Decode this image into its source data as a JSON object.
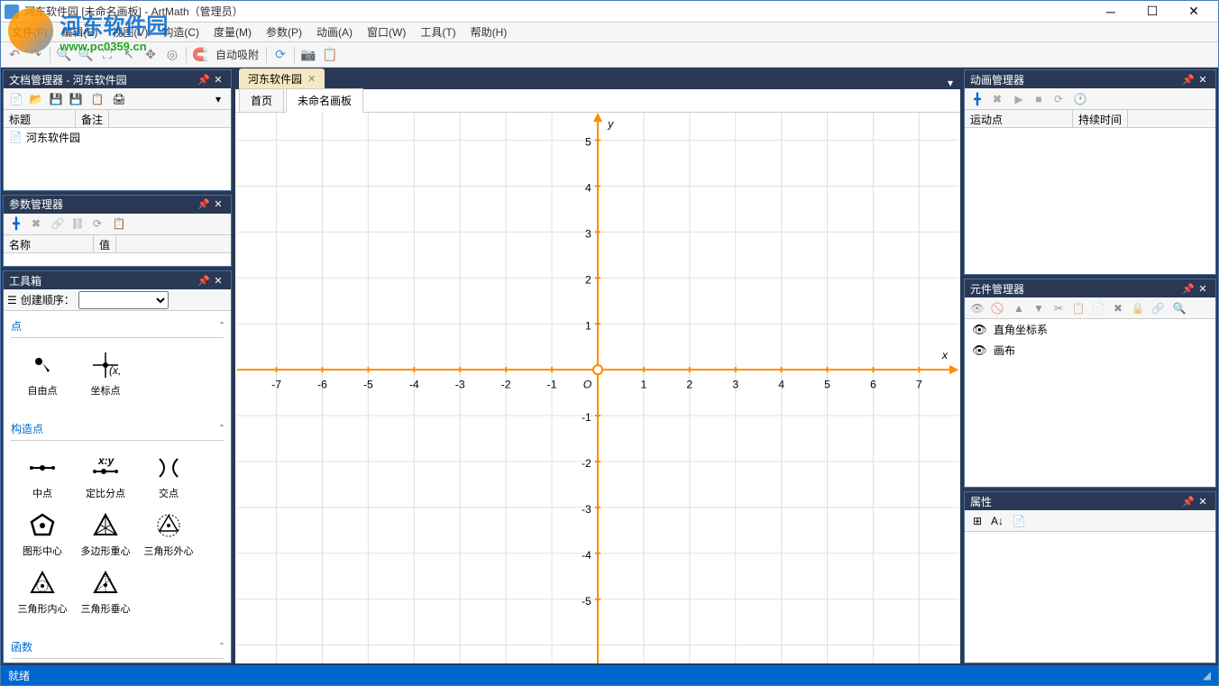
{
  "window": {
    "title": "河东软件园 [未命名画板] - ArtMath（管理员）"
  },
  "watermark": {
    "text": "河东软件园",
    "url": "www.pc0359.cn"
  },
  "menubar": [
    "文件(F)",
    "编辑(E)",
    "视图(V)",
    "构造(C)",
    "度量(M)",
    "参数(P)",
    "动画(A)",
    "窗口(W)",
    "工具(T)",
    "帮助(H)"
  ],
  "toolbar": {
    "auto_snap": "自动吸附"
  },
  "doc_mgr": {
    "title": "文档管理器 - 河东软件园",
    "cols": [
      "标题",
      "备注"
    ],
    "rows": [
      {
        "title": "河东软件园",
        "note": ""
      }
    ]
  },
  "param_mgr": {
    "title": "参数管理器",
    "cols": [
      "名称",
      "值"
    ]
  },
  "toolbox": {
    "title": "工具箱",
    "order_label": "创建顺序：",
    "sections": [
      {
        "name": "点",
        "items": [
          "自由点",
          "坐标点"
        ]
      },
      {
        "name": "构造点",
        "items": [
          "中点",
          "定比分点",
          "交点",
          "图形中心",
          "多边形重心",
          "三角形外心",
          "三角形内心",
          "三角形垂心"
        ]
      },
      {
        "name": "函数",
        "items": []
      }
    ]
  },
  "anim_mgr": {
    "title": "动画管理器",
    "cols": [
      "运动点",
      "持续时间"
    ]
  },
  "comp_mgr": {
    "title": "元件管理器",
    "items": [
      "直角坐标系",
      "画布"
    ]
  },
  "prop_mgr": {
    "title": "属性"
  },
  "doc_tabs": [
    {
      "label": "河东软件园"
    }
  ],
  "page_tabs": [
    {
      "label": "首页",
      "active": false
    },
    {
      "label": "未命名画板",
      "active": true
    }
  ],
  "statusbar": {
    "text": "就绪"
  },
  "chart_data": {
    "type": "cartesian-plane",
    "x_axis": {
      "label": "x",
      "range": [
        -7,
        7
      ],
      "ticks": [
        -7,
        -6,
        -5,
        -4,
        -3,
        -2,
        -1,
        1,
        2,
        3,
        4,
        5,
        6,
        7
      ]
    },
    "y_axis": {
      "label": "y",
      "range": [
        -5,
        5
      ],
      "ticks": [
        -5,
        -4,
        -3,
        -2,
        -1,
        1,
        2,
        3,
        4,
        5
      ]
    },
    "origin_label": "O",
    "grid": true,
    "series": []
  }
}
